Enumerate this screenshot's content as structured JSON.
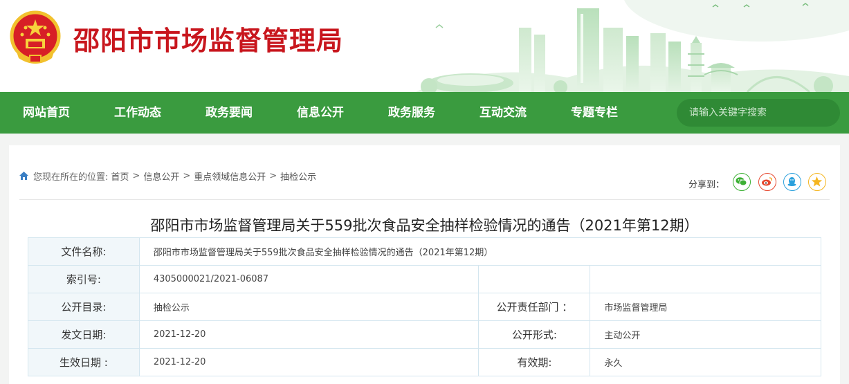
{
  "header": {
    "site_title": "邵阳市市场监督管理局"
  },
  "nav": {
    "items": [
      "网站首页",
      "工作动态",
      "政务要闻",
      "信息公开",
      "政务服务",
      "互动交流",
      "专题专栏"
    ],
    "search_placeholder": "请输入关键字搜索"
  },
  "breadcrumb": {
    "prefix": "您现在所在的位置:",
    "items": [
      "首页",
      "信息公开",
      "重点领域信息公开",
      "抽检公示"
    ]
  },
  "share": {
    "label": "分享到：",
    "buttons": [
      "wechat-icon",
      "weibo-icon",
      "qq-icon",
      "qzone-icon"
    ],
    "colors": {
      "wechat": "#3cb034",
      "weibo": "#e6462d",
      "qq": "#2aa0dc",
      "qzone": "#f5b51e"
    }
  },
  "document": {
    "title": "邵阳市市场监督管理局关于559批次食品安全抽样检验情况的通告（2021年第12期）",
    "file_name_label": "文件名称:",
    "file_name_value": "邵阳市市场监督管理局关于559批次食品安全抽样检验情况的通告（2021年第12期）",
    "index_label": "索引号:",
    "index_value": "4305000021/2021-06087",
    "catalog_label": "公开目录:",
    "catalog_value": "抽检公示",
    "dept_label": "公开责任部门 ：",
    "dept_value": "市场监督管理局",
    "issue_date_label": "发文日期:",
    "issue_date_value": "2021-12-20",
    "form_label": "公开形式:",
    "form_value": "主动公开",
    "effective_date_label": "生效日期 :",
    "effective_date_value": "2021-12-20",
    "validity_label": "有效期:",
    "validity_value": "永久"
  },
  "colors": {
    "brand_red": "#c8161d",
    "nav_green": "#3a9b3f"
  }
}
